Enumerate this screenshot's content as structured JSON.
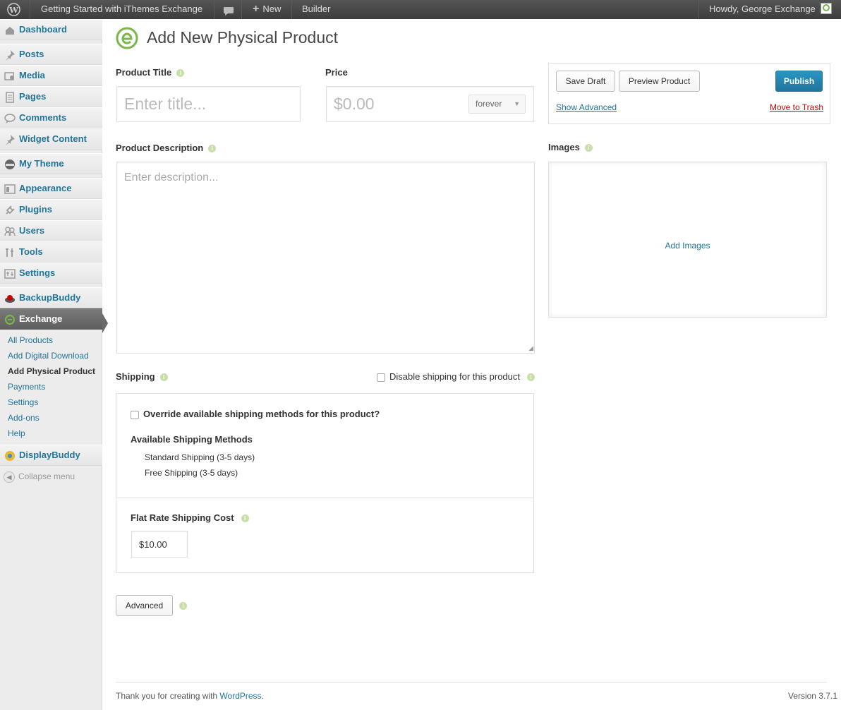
{
  "adminbar": {
    "site_name": "Getting Started with iThemes Exchange",
    "new_label": "New",
    "builder_label": "Builder",
    "howdy": "Howdy, George Exchange"
  },
  "sidebar": {
    "items": [
      {
        "label": "Dashboard",
        "icon": "dashboard-icon"
      },
      {
        "label": "Posts",
        "icon": "pin-icon"
      },
      {
        "label": "Media",
        "icon": "media-icon"
      },
      {
        "label": "Pages",
        "icon": "pages-icon"
      },
      {
        "label": "Comments",
        "icon": "comment-icon"
      },
      {
        "label": "Widget Content",
        "icon": "pin-icon"
      },
      {
        "label": "My Theme",
        "icon": "theme-icon"
      },
      {
        "label": "Appearance",
        "icon": "appearance-icon"
      },
      {
        "label": "Plugins",
        "icon": "plugin-icon"
      },
      {
        "label": "Users",
        "icon": "users-icon"
      },
      {
        "label": "Tools",
        "icon": "tools-icon"
      },
      {
        "label": "Settings",
        "icon": "settings-icon"
      },
      {
        "label": "BackupBuddy",
        "icon": "backupbuddy-icon"
      },
      {
        "label": "Exchange",
        "icon": "exchange-icon"
      },
      {
        "label": "DisplayBuddy",
        "icon": "displaybuddy-icon"
      }
    ],
    "submenu": [
      "All Products",
      "Add Digital Download",
      "Add Physical Product",
      "Payments",
      "Settings",
      "Add-ons",
      "Help"
    ],
    "collapse": "Collapse menu"
  },
  "page": {
    "title": "Add New Physical Product",
    "product_title_label": "Product Title",
    "title_placeholder": "Enter title...",
    "price_label": "Price",
    "price_placeholder": "$0.00",
    "price_period": "forever",
    "description_label": "Product Description",
    "description_placeholder": "Enter description...",
    "images_label": "Images",
    "add_images": "Add Images",
    "shipping_label": "Shipping",
    "disable_shipping": "Disable shipping for this product",
    "override_label": "Override available shipping methods for this product?",
    "available_methods_label": "Available Shipping Methods",
    "methods": [
      "Standard Shipping (3-5 days)",
      "Free Shipping (3-5 days)"
    ],
    "flat_rate_label": "Flat Rate Shipping Cost",
    "flat_rate_value": "$10.00",
    "advanced": "Advanced"
  },
  "publish_box": {
    "save_draft": "Save Draft",
    "preview": "Preview Product",
    "publish": "Publish",
    "show_advanced": "Show Advanced",
    "move_to_trash": "Move to Trash"
  },
  "footer": {
    "thanks": "Thank you for creating with",
    "wp_link": "WordPress",
    "version": "Version 3.7.1"
  },
  "colors": {
    "link": "#21759b",
    "accent": "#7ab648",
    "trash": "#bc0b0b"
  }
}
